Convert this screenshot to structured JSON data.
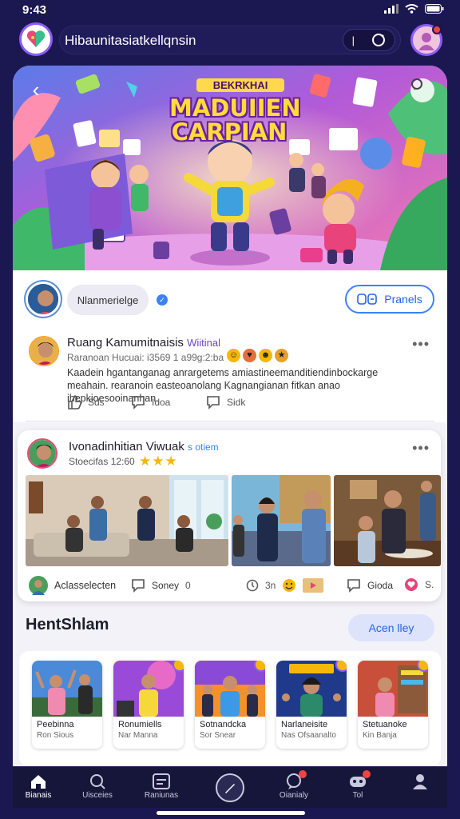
{
  "status": {
    "time": "9:43"
  },
  "header": {
    "title": "Hibaunitasiatkellqnsin",
    "search_divider": "|"
  },
  "hero": {
    "subtitle": "BEKRKHAI",
    "title_line1": "MADUIIEN",
    "title_line2": "CARPIAN"
  },
  "channel": {
    "name": "Nlanmerielge",
    "action_label": "Pranels"
  },
  "post1": {
    "title": "Ruang Kamumitnaisis",
    "tag": "Wiitinal",
    "meta": "Raranoan Hucuai: i3569 1 a99g:2:ba",
    "body": "Kaadein hgantanganag anrargetems amiastineemanditiendinbockarge meahain. rearanoin easteoanolang Kagnangianan fitkan anao ihepkioesooinanhan.",
    "likes": "Sds",
    "comments": "Idoa",
    "shares": "Sidk"
  },
  "post2": {
    "title": "Ivonadinhitian Viwuak",
    "subtitle": "s otiem",
    "meta": "Stoecifas 12:60",
    "author_name": "Aclasselecten",
    "comment_label": "Soney",
    "comment_count": "0",
    "count_a": "3n",
    "reply_label": "Gioda",
    "count_b": "S.",
    "more_dots": "•••"
  },
  "section": {
    "title": "HentShlam",
    "button": "Acen lley"
  },
  "carousel": [
    {
      "title": "Peebinna",
      "sub": "Ron Sious"
    },
    {
      "title": "Ronumiells",
      "sub": "Nar Manna"
    },
    {
      "title": "Sotnandcka",
      "sub": "Sor Snear"
    },
    {
      "title": "Narlaneisite",
      "sub": "Nas Ofsaanalto"
    },
    {
      "title": "Stetuanoke",
      "sub": "Kin Banja"
    }
  ],
  "nav": [
    {
      "label": "Bianais",
      "icon": "home-icon"
    },
    {
      "label": "Uisceies",
      "icon": "search-icon"
    },
    {
      "label": "Raniunas",
      "icon": "inbox-icon"
    },
    {
      "label": "Oianialy",
      "icon": "chat-icon"
    },
    {
      "label": "Tol",
      "icon": "gamepad-icon"
    }
  ],
  "colors": {
    "bg": "#1b1750",
    "accent": "#8b5cf6",
    "link": "#2563eb",
    "star": "#f5b70a"
  }
}
